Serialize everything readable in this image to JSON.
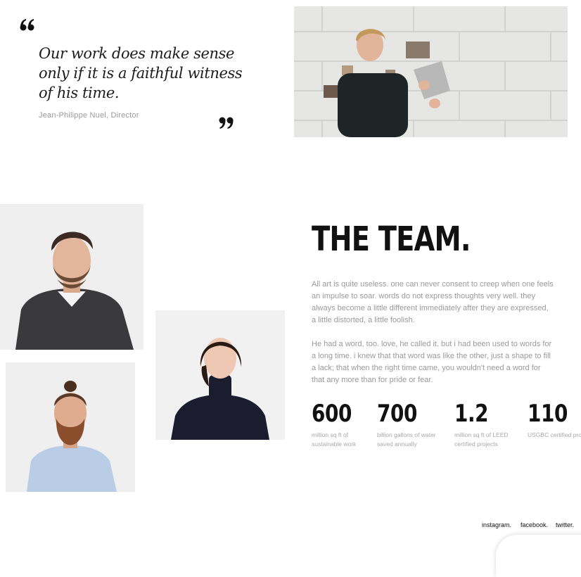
{
  "quote": {
    "text": "Our work does make sense only if it is a faithful witness of his time.",
    "author": "Jean-Philippe Nuel, Director",
    "open_icon": "quote-open-icon",
    "close_icon": "quote-close-icon"
  },
  "team": {
    "title": "THE TEAM.",
    "paragraphs": [
      "All art is quite useless. one can never consent to creep when one feels an impulse to soar. words do not express thoughts very well. they always become a little different immediately after they are expressed, a little distorted, a little foolish.",
      "He had a word, too. love, he called it. but i had been used to words for a long time. i knew that that word was like the other, just a shape to fill a lack; that when the right time came, you wouldn't need a word for that any more than for pride or fear."
    ],
    "stats": [
      {
        "value": "600",
        "label": "million sq ft of sustainable work"
      },
      {
        "value": "700",
        "label": "billion gallons of water saved annually"
      },
      {
        "value": "1.2",
        "label": "million sq ft of LEED certified projects"
      },
      {
        "value": "110",
        "label": "USGBC certified projects"
      }
    ]
  },
  "footer": {
    "social": [
      "instagram.",
      "facebook.",
      "twitter."
    ]
  },
  "colors": {
    "text_dark": "#111111",
    "text_muted": "#9a9a9a",
    "background": "#ffffff"
  }
}
